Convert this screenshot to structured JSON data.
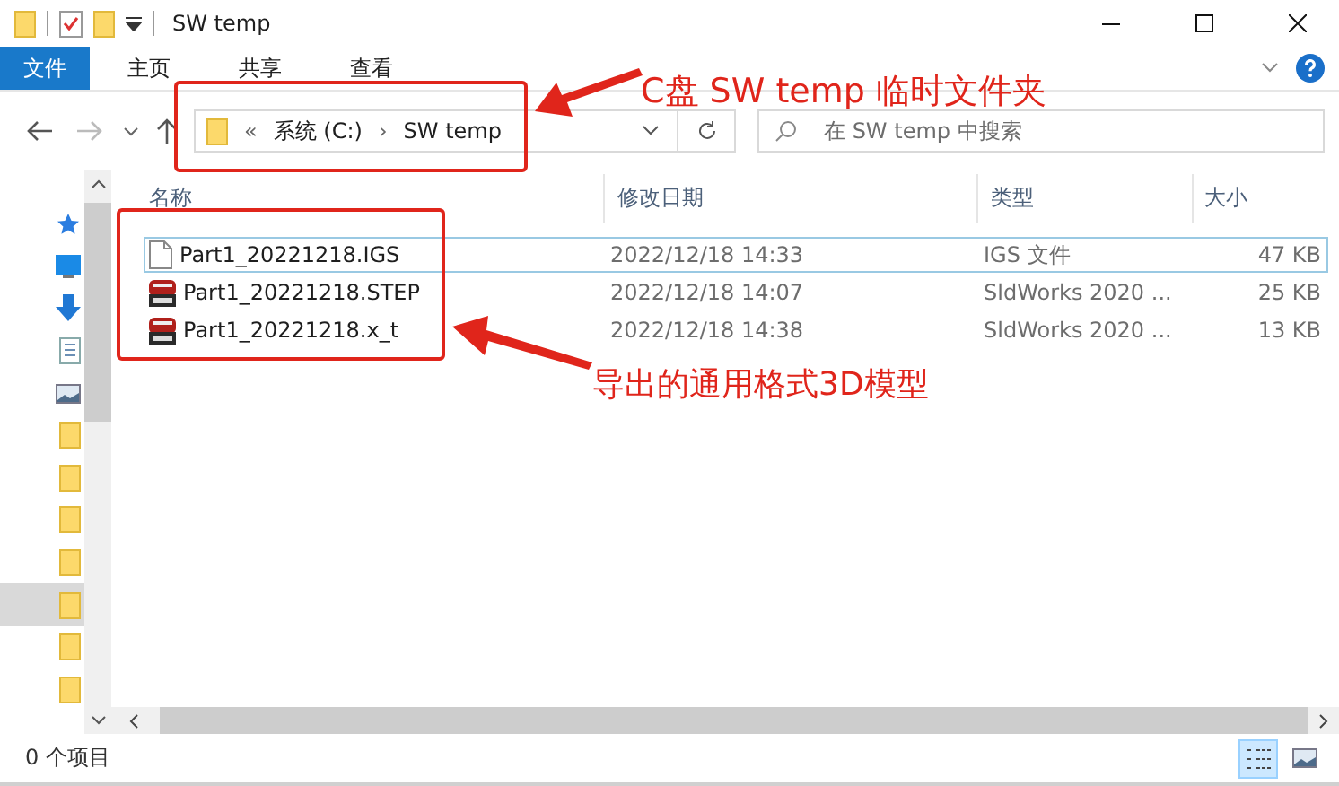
{
  "window": {
    "title": "SW temp"
  },
  "ribbon_tabs": [
    {
      "label": "文件",
      "selected": true
    },
    {
      "label": "主页",
      "selected": false
    },
    {
      "label": "共享",
      "selected": false
    },
    {
      "label": "查看",
      "selected": false
    }
  ],
  "address_bar": {
    "overflow": "«",
    "segments": [
      "系统 (C:)",
      "SW temp"
    ],
    "separator": "›"
  },
  "search": {
    "placeholder": "在 SW temp 中搜索"
  },
  "nav_pane": [
    {
      "kind": "pin",
      "selected": false
    },
    {
      "kind": "desktop",
      "selected": false
    },
    {
      "kind": "download",
      "selected": false
    },
    {
      "kind": "document",
      "selected": false
    },
    {
      "kind": "picture",
      "selected": false
    },
    {
      "kind": "folder",
      "selected": false
    },
    {
      "kind": "folder",
      "selected": false
    },
    {
      "kind": "folder",
      "selected": false
    },
    {
      "kind": "folder",
      "selected": false
    },
    {
      "kind": "folder",
      "selected": true
    },
    {
      "kind": "folder",
      "selected": false
    },
    {
      "kind": "folder",
      "selected": false
    }
  ],
  "table": {
    "columns": [
      "名称",
      "修改日期",
      "类型",
      "大小"
    ],
    "rows": [
      {
        "kind": "document",
        "focused": true,
        "name": "Part1_20221218.IGS",
        "modified": "2022/12/18 14:33",
        "type": "IGS 文件",
        "size": "47 KB"
      },
      {
        "kind": "solidworks",
        "focused": false,
        "name": "Part1_20221218.STEP",
        "modified": "2022/12/18 14:07",
        "type": "SldWorks 2020 ...",
        "size": "25 KB"
      },
      {
        "kind": "solidworks",
        "focused": false,
        "name": "Part1_20221218.x_t",
        "modified": "2022/12/18 14:38",
        "type": "SldWorks 2020 ...",
        "size": "13 KB"
      }
    ]
  },
  "status_bar": {
    "item_count": "0 个项目",
    "view_buttons": [
      {
        "kind": "details",
        "selected": true
      },
      {
        "kind": "thumbnails",
        "selected": false
      }
    ]
  },
  "annotations": [
    {
      "text": "C盘 SW temp 临时文件夹"
    },
    {
      "text": "导出的通用格式3D模型"
    }
  ]
}
